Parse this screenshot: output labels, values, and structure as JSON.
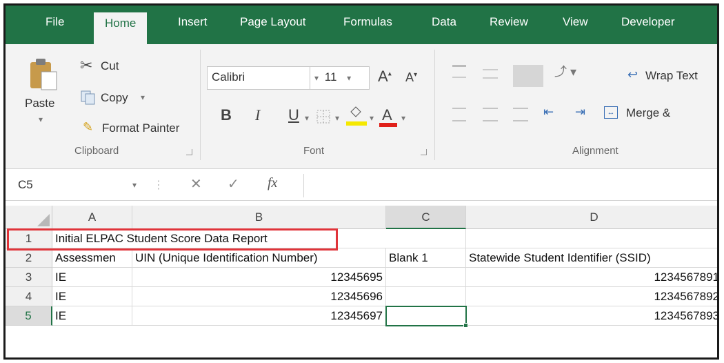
{
  "tabs": [
    "File",
    "Home",
    "Insert",
    "Page Layout",
    "Formulas",
    "Data",
    "Review",
    "View",
    "Developer"
  ],
  "active_tab": "Home",
  "clipboard": {
    "paste_label": "Paste",
    "cut_label": "Cut",
    "copy_label": "Copy",
    "format_painter_label": "Format Painter",
    "group_label": "Clipboard"
  },
  "font": {
    "font_name": "Calibri",
    "font_size": "11",
    "bold": "B",
    "italic": "I",
    "underline": "U",
    "increase_size": "A",
    "decrease_size": "A",
    "font_color_glyph": "A",
    "highlight_color": "#f5e800",
    "font_color": "#e0201a",
    "group_label": "Font"
  },
  "alignment": {
    "wrap_text_label": "Wrap Text",
    "merge_label": "Merge &",
    "group_label": "Alignment"
  },
  "formula_bar": {
    "name_box": "C5",
    "fx_label": "fx",
    "formula": ""
  },
  "columns": [
    "A",
    "B",
    "C",
    "D"
  ],
  "selected_column": "C",
  "rows": [
    {
      "num": "1",
      "cells": [
        "Initial ELPAC Student Score Data Report",
        "",
        "",
        ""
      ]
    },
    {
      "num": "2",
      "cells": [
        "Assessmen",
        "UIN (Unique Identification Number)",
        "Blank 1",
        "Statewide Student Identifier (SSID)"
      ]
    },
    {
      "num": "3",
      "cells": [
        "IE",
        "12345695",
        "",
        "1234567891"
      ]
    },
    {
      "num": "4",
      "cells": [
        "IE",
        "12345696",
        "",
        "1234567892"
      ]
    },
    {
      "num": "5",
      "cells": [
        "IE",
        "12345697",
        "",
        "1234567893"
      ]
    }
  ],
  "colors": {
    "accent": "#217346",
    "annotation": "#e0343a"
  }
}
